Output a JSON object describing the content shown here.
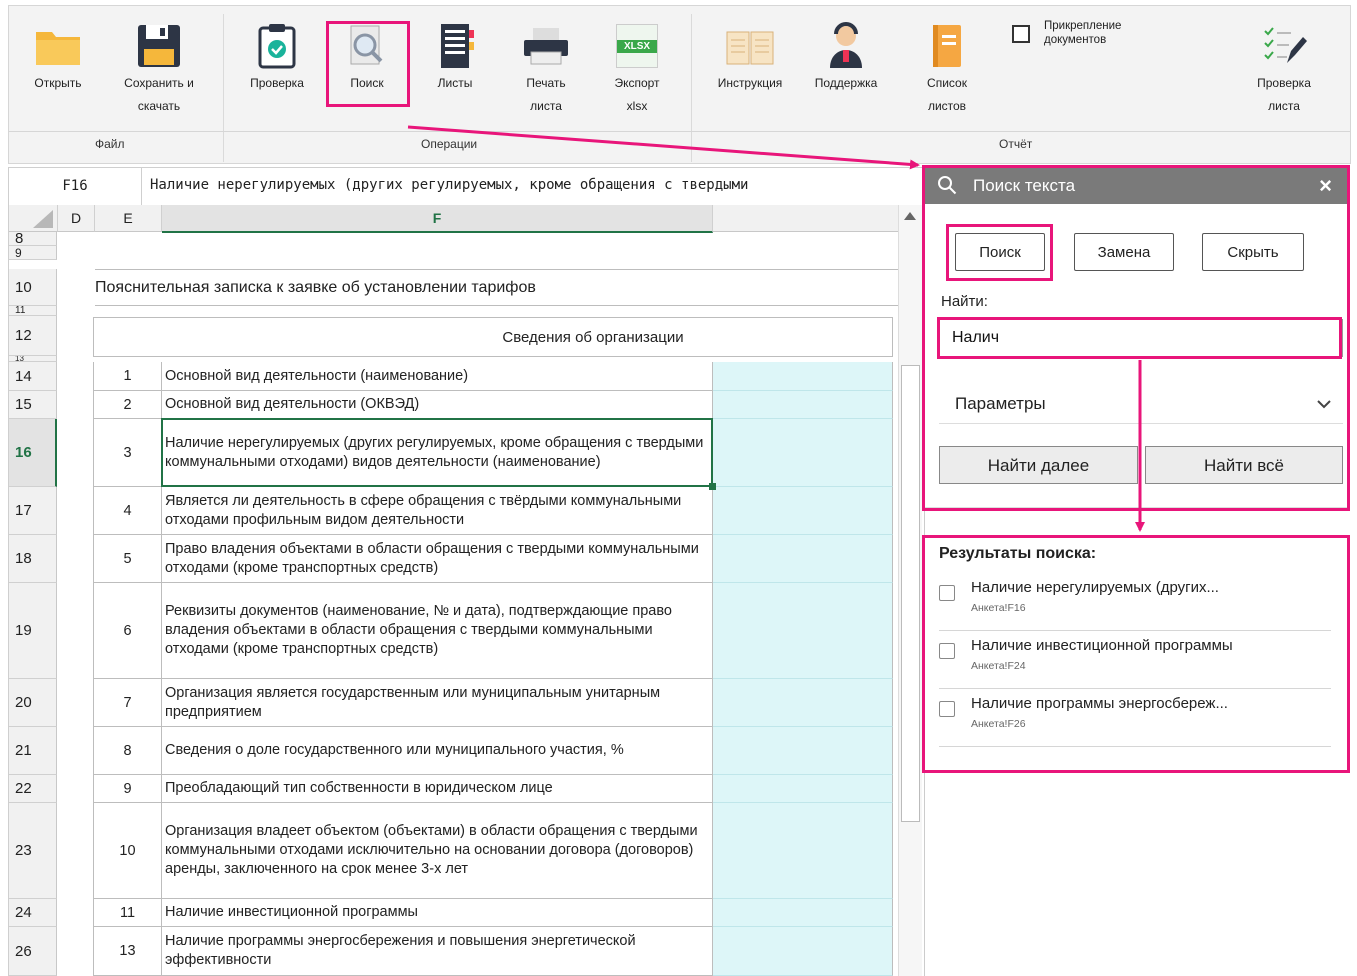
{
  "ribbon": {
    "buttons": [
      {
        "label": "Открыть",
        "icon": "folder-icon"
      },
      {
        "label": "Сохранить и\nскачать",
        "icon": "save-icon"
      },
      {
        "label": "Проверка",
        "icon": "clipboard-check-icon"
      },
      {
        "label": "Поиск",
        "icon": "search-document-icon"
      },
      {
        "label": "Листы",
        "icon": "sheets-icon"
      },
      {
        "label": "Печать\nлиста",
        "icon": "printer-icon"
      },
      {
        "label": "Экспорт\nxlsx",
        "icon": "xlsx-icon"
      },
      {
        "label": "Инструкция",
        "icon": "book-icon"
      },
      {
        "label": "Поддержка",
        "icon": "support-icon"
      },
      {
        "label": "Список\nлистов",
        "icon": "list-book-icon"
      },
      {
        "label": "Проверка\nлиста",
        "icon": "checklist-pen-icon"
      }
    ],
    "attach_checkbox_label": "Прикрепление\nдокументов",
    "groups": {
      "file": "Файл",
      "operations": "Операции",
      "report": "Отчёт"
    },
    "xlsx_badge": "XLSX"
  },
  "formula_bar": {
    "cell_ref": "F16",
    "text": "Наличие нерегулируемых (других регулируемых, кроме обращения с твердыми"
  },
  "sheet": {
    "columns": [
      "D",
      "E",
      "F"
    ],
    "title": "Пояснительная записка к заявке об установлении тарифов",
    "section": "Сведения об организации",
    "row_numbers": [
      "8",
      "9",
      "10",
      "11",
      "12",
      "13",
      "14",
      "15",
      "16",
      "17",
      "18",
      "19",
      "20",
      "21",
      "22",
      "23",
      "24",
      "26"
    ],
    "table_rows": [
      {
        "row": "14",
        "n": "1",
        "text": "Основной вид деятельности (наименование)"
      },
      {
        "row": "15",
        "n": "2",
        "text": "Основной вид деятельности (ОКВЭД)"
      },
      {
        "row": "16",
        "n": "3",
        "text": "Наличие нерегулируемых (других регулируемых, кроме обращения с твердыми коммунальными отходами) видов деятельности (наименование)"
      },
      {
        "row": "17",
        "n": "4",
        "text": "Является ли деятельность в сфере обращения с твёрдыми коммунальными отходами профильным видом деятельности"
      },
      {
        "row": "18",
        "n": "5",
        "text": "Право владения объектами в области обращения с твердыми коммунальными отходами (кроме транспортных средств)"
      },
      {
        "row": "19",
        "n": "6",
        "text": "Реквизиты документов (наименование, № и дата), подтверждающие право владения объектами в области обращения с твердыми коммунальными отходами (кроме транспортных средств)"
      },
      {
        "row": "20",
        "n": "7",
        "text": "Организация является государственным или муниципальным унитарным предприятием"
      },
      {
        "row": "21",
        "n": "8",
        "text": "Сведения о доле государственного или муниципального участия, %"
      },
      {
        "row": "22",
        "n": "9",
        "text": "Преобладающий тип собственности в юридическом лице"
      },
      {
        "row": "23",
        "n": "10",
        "text": "Организация владеет объектом (объектами) в области обращения с твердыми коммунальными отходами исключительно на основании договора (договоров) аренды, заключенного на срок менее 3-х лет"
      },
      {
        "row": "24",
        "n": "11",
        "text": "Наличие инвестиционной программы"
      },
      {
        "row": "26",
        "n": "13",
        "text": "Наличие программы энергосбережения и повышения энергетической эффективности"
      }
    ]
  },
  "panel": {
    "title": "Поиск текста",
    "close": "×",
    "tabs": [
      "Поиск",
      "Замена",
      "Скрыть"
    ],
    "find_label": "Найти:",
    "find_value": "Налич",
    "params_label": "Параметры",
    "find_next": "Найти далее",
    "find_all": "Найти всё",
    "results_title": "Результаты поиска:",
    "results": [
      {
        "title": "Наличие нерегулируемых (других...",
        "ref": "Анкета!F16"
      },
      {
        "title": "Наличие инвестиционной программы",
        "ref": "Анкета!F24"
      },
      {
        "title": "Наличие программы энергосбереж...",
        "ref": "Анкета!F26"
      }
    ]
  },
  "colors": {
    "highlight": "#e8157a",
    "selection": "#217346",
    "input_cell": "#ddf6f8"
  }
}
